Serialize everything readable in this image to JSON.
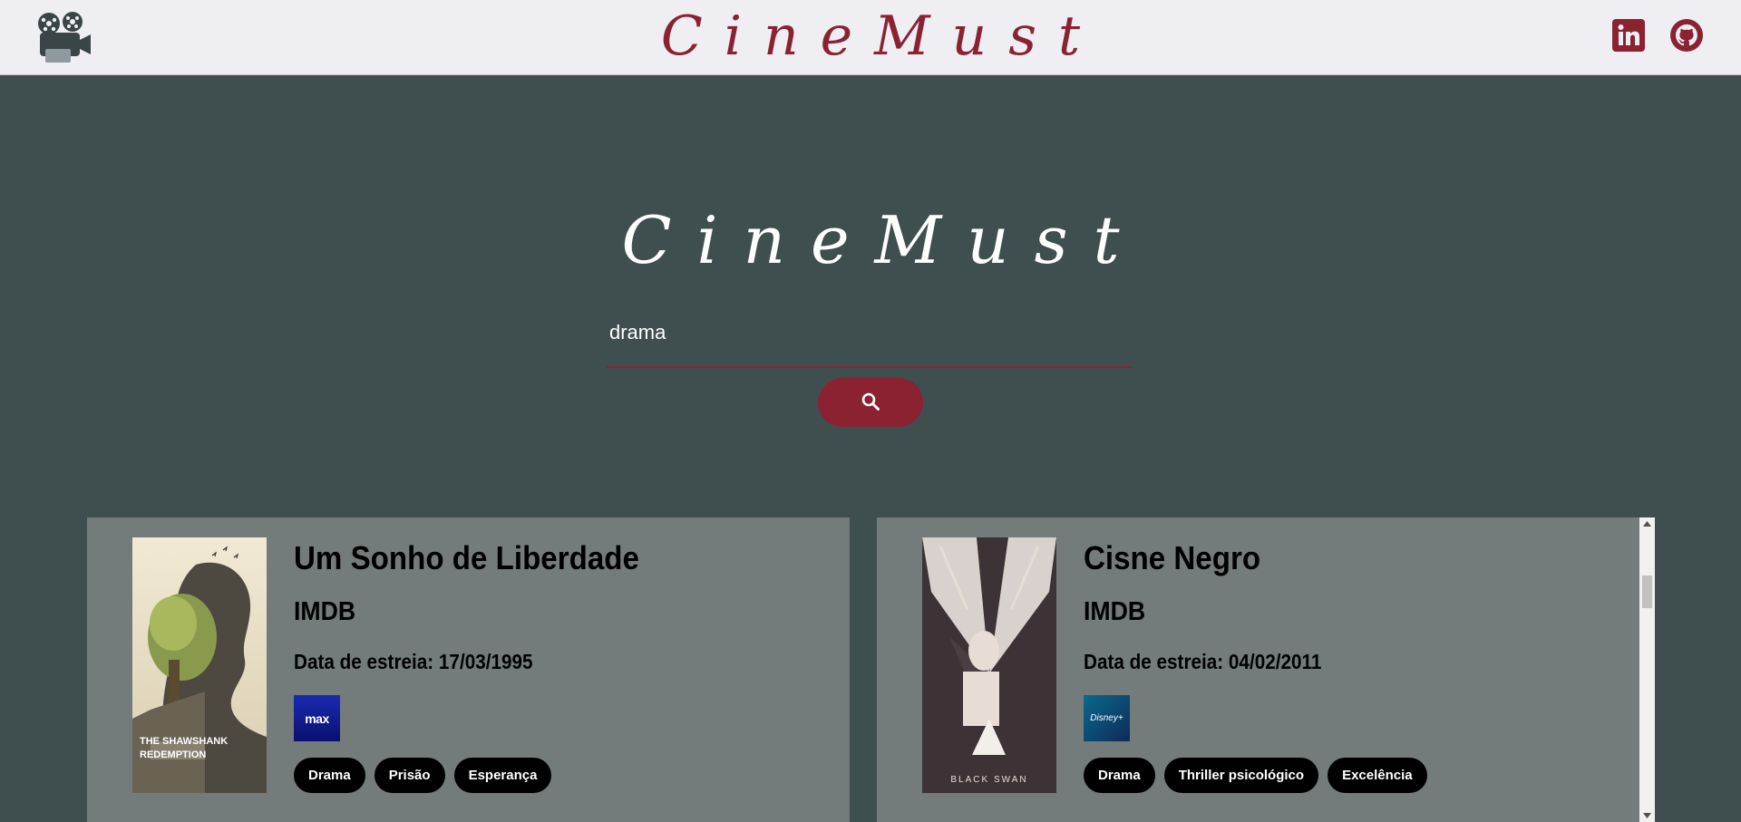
{
  "header": {
    "brand": "CineMust",
    "icons": [
      "film-projector-icon",
      "linkedin-icon",
      "github-icon"
    ]
  },
  "hero": {
    "title": "CineMust"
  },
  "search": {
    "value": "drama",
    "placeholder": ""
  },
  "movies": [
    {
      "title": "Um Sonho de Liberdade",
      "rating_label": "IMDB",
      "release": "Data de estreia: 17/03/1995",
      "provider": "max",
      "poster_text": [
        "THE SHAWSHANK",
        "REDEMPTION"
      ],
      "tags": [
        "Drama",
        "Prisão",
        "Esperança"
      ]
    },
    {
      "title": "Cisne Negro",
      "rating_label": "IMDB",
      "release": "Data de estreia: 04/02/2011",
      "provider": "Disney+",
      "poster_text": [
        "BLACK SWAN"
      ],
      "tags": [
        "Drama",
        "Thriller psicológico",
        "Excelência"
      ]
    }
  ],
  "colors": {
    "accent": "#8a2232",
    "background": "#3f4f4f",
    "card": "#737c7a",
    "header": "#efeef3"
  }
}
